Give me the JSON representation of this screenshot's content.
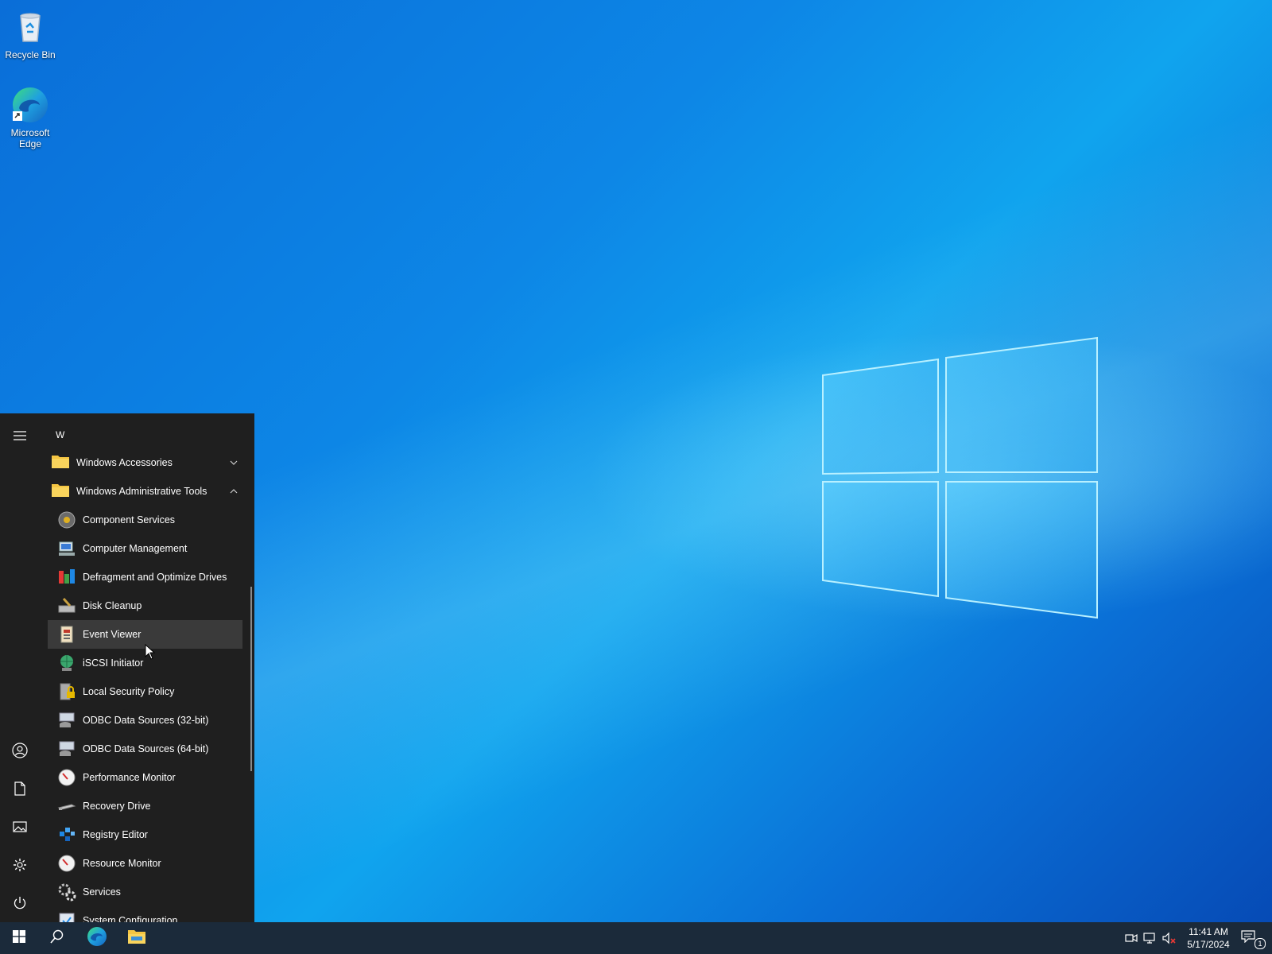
{
  "desktop": {
    "icons": [
      {
        "label": "Recycle Bin",
        "icon": "recycle-bin-icon"
      },
      {
        "label": "Microsoft\nEdge",
        "icon": "edge-icon"
      }
    ]
  },
  "start_menu": {
    "section_letter": "W",
    "folders": [
      {
        "label": "Windows Accessories",
        "icon": "folder-icon",
        "expanded": false
      },
      {
        "label": "Windows Administrative Tools",
        "icon": "folder-icon",
        "expanded": true
      }
    ],
    "items": [
      {
        "label": "Component Services",
        "icon": "component-services-icon"
      },
      {
        "label": "Computer Management",
        "icon": "computer-management-icon"
      },
      {
        "label": "Defragment and Optimize Drives",
        "icon": "defragment-icon"
      },
      {
        "label": "Disk Cleanup",
        "icon": "disk-cleanup-icon"
      },
      {
        "label": "Event Viewer",
        "icon": "event-viewer-icon",
        "hovered": true
      },
      {
        "label": "iSCSI Initiator",
        "icon": "iscsi-icon"
      },
      {
        "label": "Local Security Policy",
        "icon": "security-policy-icon"
      },
      {
        "label": "ODBC Data Sources (32-bit)",
        "icon": "odbc-icon"
      },
      {
        "label": "ODBC Data Sources (64-bit)",
        "icon": "odbc-icon"
      },
      {
        "label": "Performance Monitor",
        "icon": "performance-monitor-icon"
      },
      {
        "label": "Recovery Drive",
        "icon": "recovery-drive-icon"
      },
      {
        "label": "Registry Editor",
        "icon": "registry-editor-icon"
      },
      {
        "label": "Resource Monitor",
        "icon": "resource-monitor-icon"
      },
      {
        "label": "Services",
        "icon": "services-icon"
      },
      {
        "label": "System Configuration",
        "icon": "system-configuration-icon"
      }
    ],
    "rail": [
      "hamburger-menu-icon",
      "user-account-icon",
      "documents-icon",
      "pictures-icon",
      "settings-gear-icon",
      "power-icon"
    ]
  },
  "taskbar": {
    "pinned": [
      "start-windows-icon",
      "search-icon",
      "edge-icon",
      "file-explorer-icon"
    ],
    "tray": [
      "meet-now-icon",
      "network-icon",
      "volume-muted-icon"
    ],
    "time": "11:41 AM",
    "date": "5/17/2024",
    "notification_count": "1"
  },
  "colors": {
    "start_bg": "#1f1f1f",
    "hover_bg": "#3a3a3a",
    "taskbar_bg": "#1b2a3a",
    "folder_yellow": "#f4c542"
  }
}
